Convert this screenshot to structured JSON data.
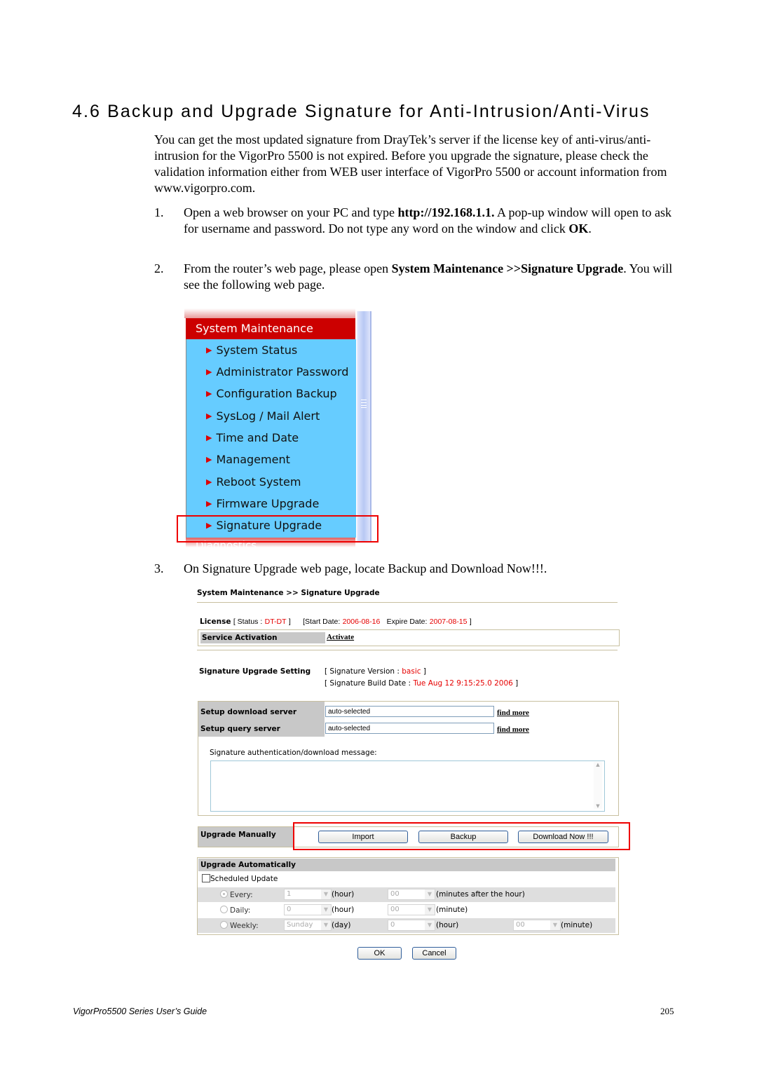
{
  "heading": "4.6 Backup and Upgrade Signature for Anti-Intrusion/Anti-Virus",
  "intro": "You can get the most updated signature from DrayTek’s server if the license key of anti-virus/anti-intrusion for the VigorPro 5500 is not expired. Before you upgrade the signature, please check the validation information either from WEB user interface of VigorPro 5500 or account information from www.vigorpro.com.",
  "steps": [
    {
      "num": "1.",
      "pre": "Open a web browser on your PC and type ",
      "bold1": "http://192.168.1.1.",
      "mid": " A pop-up window will open to ask for username and password. Do not type any word on the window and click ",
      "bold2": "OK",
      "post": "."
    },
    {
      "num": "2.",
      "pre": "From the router’s web page, please open ",
      "bold1": "System Maintenance >>Signature Upgrade",
      "post": ". You will see the following web page."
    },
    {
      "num": "3.",
      "text": "On Signature Upgrade web page, locate Backup and Download Now!!!."
    }
  ],
  "menu": {
    "section": "System Maintenance",
    "items": [
      "System Status",
      "Administrator Password",
      "Configuration Backup",
      "SysLog / Mail Alert",
      "Time and Date",
      "Management",
      "Reboot System",
      "Firmware Upgrade",
      "Signature Upgrade"
    ],
    "next_section": "Diagnostics",
    "highlighted": "Signature Upgrade"
  },
  "webpage": {
    "breadcrumb": "System Maintenance >> Signature Upgrade",
    "license": {
      "label": "License",
      "status_label": "[ Status  :",
      "status_value": "DT-DT",
      "status_close": "]",
      "start_label": "[Start Date:",
      "start_value": "2006-08-16",
      "expire_label": "Expire Date:",
      "expire_value": "2007-08-15",
      "close": "]"
    },
    "service_activation": {
      "label": "Service Activation",
      "link": "Activate"
    },
    "signature_setting": {
      "label": "Signature Upgrade Setting",
      "version_label": "[ Signature Version  :",
      "version_value": "basic",
      "version_close": "]",
      "build_label": "[ Signature Build Date  :",
      "build_value": "Tue Aug 12 9:15:25.0 2006",
      "build_close": "]"
    },
    "servers": [
      {
        "label": "Setup download server",
        "value": "auto-selected",
        "link": "find more"
      },
      {
        "label": "Setup query server",
        "value": "auto-selected",
        "link": "find more"
      }
    ],
    "message_label": "Signature authentication/download message:",
    "message_value": "",
    "upgrade_manually": {
      "label": "Upgrade Manually",
      "buttons": [
        "Import",
        "Backup",
        "Download Now !!!"
      ]
    },
    "upgrade_auto": {
      "label": "Upgrade Automatically",
      "scheduled_label": "Scheduled Update",
      "scheduled_checked": false,
      "rows": [
        {
          "radio": "Every:",
          "selected": true,
          "f1": "1",
          "u1": "(hour)",
          "f2": "00",
          "u2": "(minutes after the hour)"
        },
        {
          "radio": "Daily:",
          "selected": false,
          "f1": "0",
          "u1": "(hour)",
          "f2": "00",
          "u2": "(minute)"
        },
        {
          "radio": "Weekly:",
          "selected": false,
          "f1": "Sunday",
          "u1": "(day)",
          "f2": "0",
          "u2": "(hour)",
          "f3": "00",
          "u3": "(minute)"
        }
      ]
    },
    "ok": "OK",
    "cancel": "Cancel"
  },
  "footer": {
    "left": "VigorPro5500 Series User’s Guide",
    "page": "205"
  },
  "colors": {
    "menu_header": "#cc0000",
    "menu_body": "#66ccff",
    "highlight_box": "#ee0000",
    "status_red": "#e60000"
  }
}
